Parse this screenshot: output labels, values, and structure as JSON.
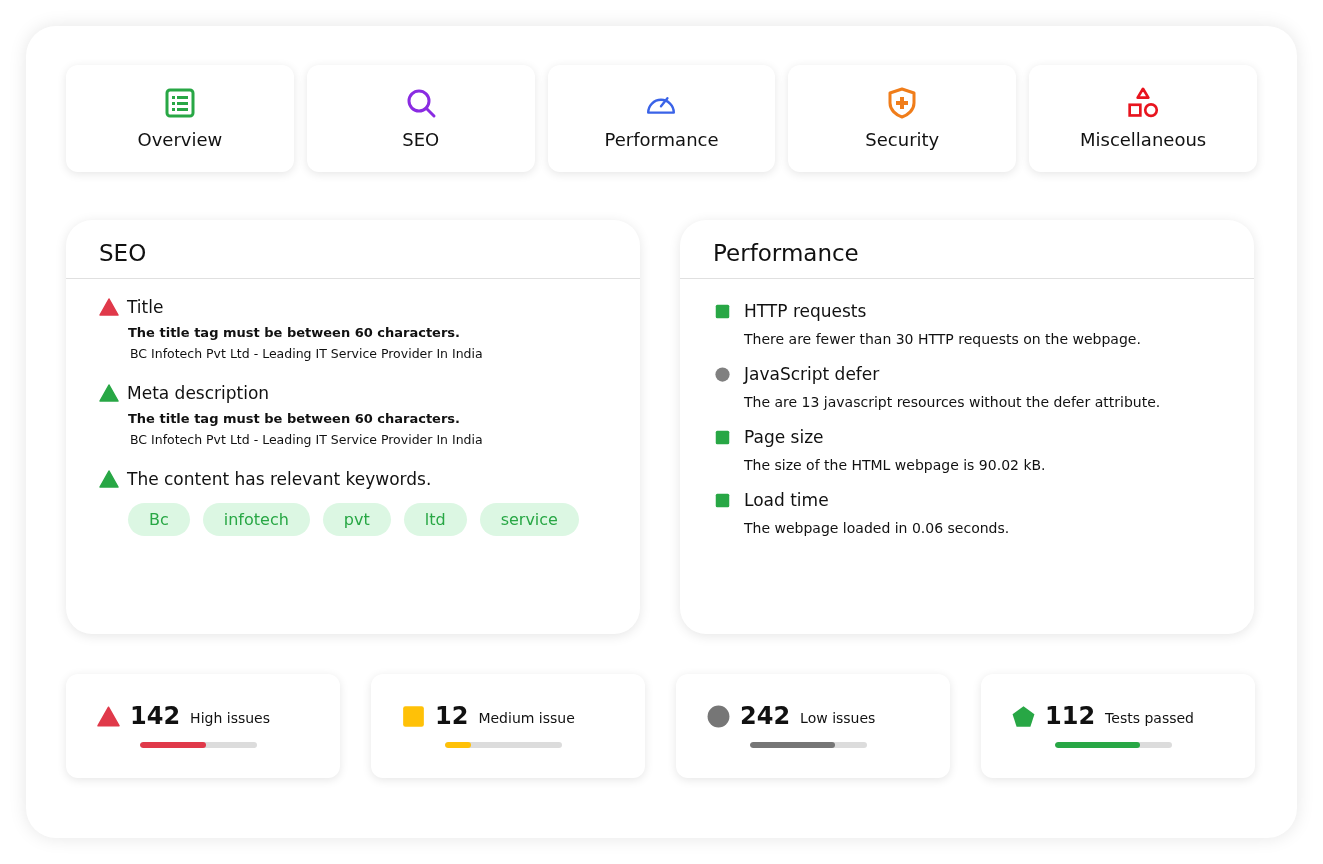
{
  "tabs": [
    {
      "label": "Overview",
      "kind": "list"
    },
    {
      "label": "SEO",
      "kind": "search"
    },
    {
      "label": "Performance",
      "kind": "gauge"
    },
    {
      "label": "Security",
      "kind": "shield"
    },
    {
      "label": "Miscellaneous",
      "kind": "shapes"
    }
  ],
  "seo": {
    "title": "SEO",
    "items": [
      {
        "kind": "triangle",
        "color": "#e0394a",
        "title": "Title",
        "message": "The title tag must be between 60 characters.",
        "value": "BC Infotech Pvt Ltd - Leading IT Service Provider In India"
      },
      {
        "kind": "triangle",
        "color": "#28a745",
        "title": "Meta description",
        "message": "The title tag must be between 60 characters.",
        "value": "BC Infotech Pvt Ltd - Leading IT Service Provider In India"
      },
      {
        "kind": "triangle",
        "color": "#28a745",
        "title": "The content has relevant keywords.",
        "keywords": [
          "Bc",
          "infotech",
          "pvt",
          "ltd",
          "service"
        ]
      }
    ]
  },
  "performance": {
    "title": "Performance",
    "items": [
      {
        "kind": "square",
        "color": "#28a745",
        "title": "HTTP requests",
        "message": "There are fewer than 30 HTTP requests on the webpage."
      },
      {
        "kind": "circle",
        "color": "#808080",
        "title": "JavaScript defer",
        "message": "The are 13 javascript resources without the defer attribute."
      },
      {
        "kind": "square",
        "color": "#28a745",
        "title": "Page size",
        "message": "The size of the HTML webpage is 90.02 kB."
      },
      {
        "kind": "square",
        "color": "#28a745",
        "title": "Load time",
        "message": "The webpage loaded in 0.06 seconds."
      }
    ]
  },
  "summary": [
    {
      "kind": "triangle",
      "color": "#e0394a",
      "count": "142",
      "label": "High issues",
      "level": 0.56
    },
    {
      "kind": "square",
      "color": "#ffc107",
      "count": "12",
      "label": "Medium issue",
      "level": 0.22
    },
    {
      "kind": "circle",
      "color": "#767676",
      "count": "242",
      "label": "Low issues",
      "level": 0.73
    },
    {
      "kind": "pentagon",
      "color": "#28a745",
      "count": "112",
      "label": "Tests passed",
      "level": 0.73
    }
  ]
}
